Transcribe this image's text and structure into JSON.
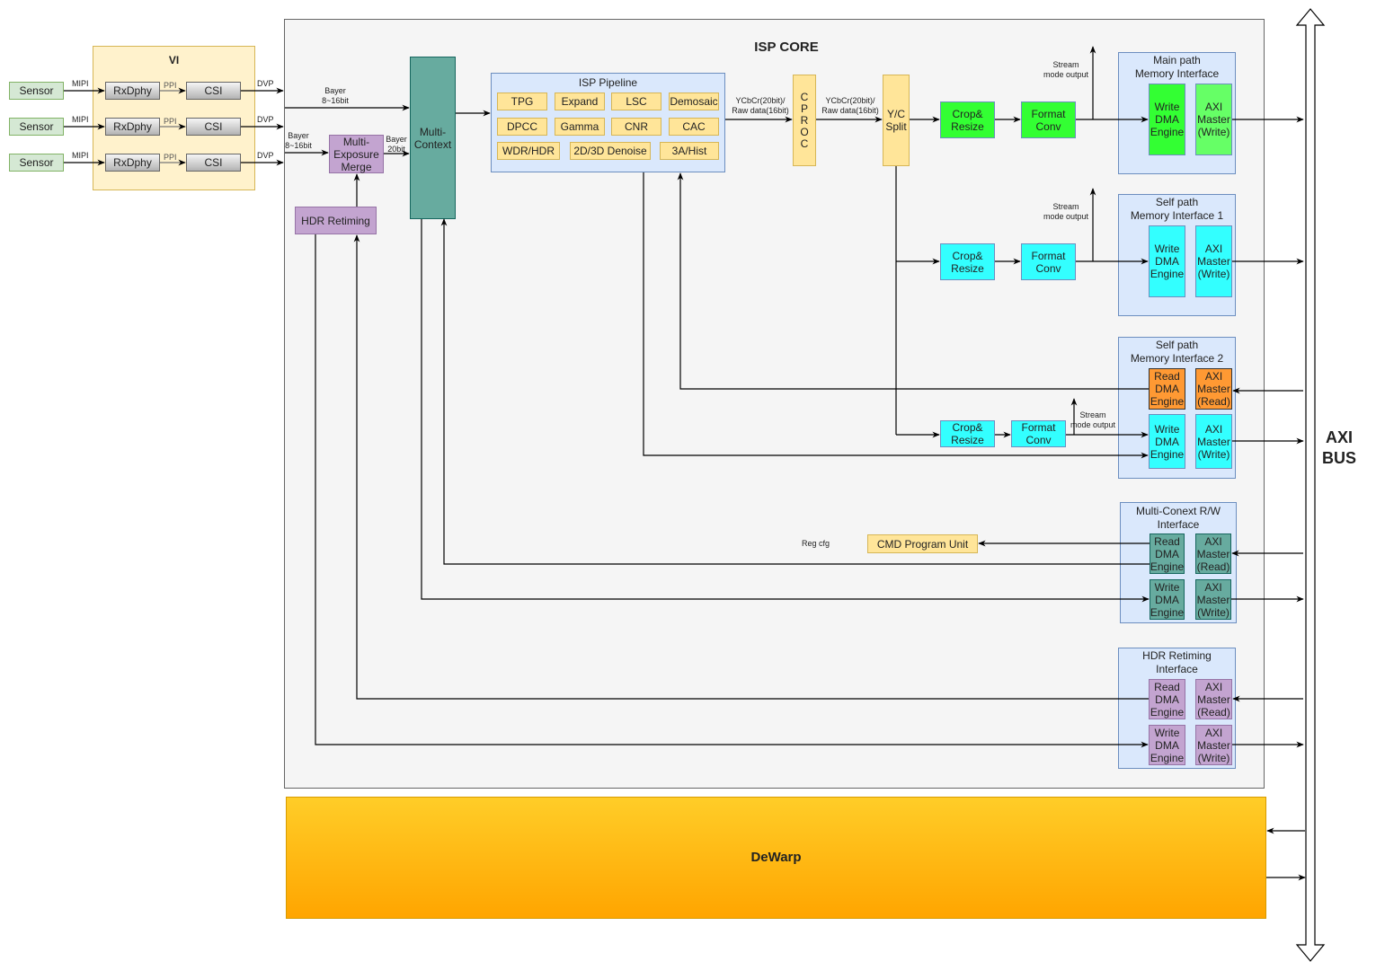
{
  "vi": {
    "title": "VI",
    "sensors": [
      "Sensor",
      "Sensor",
      "Sensor"
    ],
    "rxdphy": [
      "RxDphy",
      "RxDphy",
      "RxDphy"
    ],
    "csi": [
      "CSI",
      "CSI",
      "CSI"
    ],
    "mipi": "MIPI",
    "ppi": "PPI",
    "dvp": "DVP"
  },
  "core": {
    "title": "ISP CORE",
    "bayer_top": "Bayer\n8~16bit",
    "bayer_left": "Bayer\n8~16bit",
    "bayer_20": "Bayer\n20bit",
    "multi_exposure": "Multi-\nExposure\nMerge",
    "hdr_retiming": "HDR Retiming",
    "multi_context": "Multi-\nContext",
    "pipeline": {
      "title": "ISP Pipeline",
      "modules": [
        "TPG",
        "Expand",
        "LSC",
        "Demosaic",
        "DPCC",
        "Gamma",
        "CNR",
        "CAC",
        "WDR/HDR",
        "2D/3D Denoise",
        "3A/Hist"
      ]
    },
    "ycbcr_1": "YCbCr(20bit)/\nRaw data(16bit)",
    "ycbcr_2": "YCbCr(20bit)/\nRaw data(16bit)",
    "cproc": "C\nP\nR\nO\nC",
    "yc_split": "Y/C\nSplit",
    "crop": "Crop&\nResize",
    "format": "Format\nConv",
    "stream_output": "Stream\nmode output",
    "reg_cfg": "Reg cfg",
    "cmd_unit": "CMD Program Unit"
  },
  "interfaces": {
    "main": "Main path\nMemory Interface",
    "self1": "Self path\nMemory Interface 1",
    "self2": "Self path\nMemory Interface 2",
    "multi": "Multi-Conext R/W\nInterface",
    "hdr": "HDR Retiming\nInterface",
    "write_dma": "Write\nDMA\nEngine",
    "read_dma": "Read\nDMA\nEngine",
    "axi_write": "AXI\nMaster\n(Write)",
    "axi_read": "AXI\nMaster\n(Read)"
  },
  "dewarp": "DeWarp",
  "axi_bus": "AXI\nBUS"
}
